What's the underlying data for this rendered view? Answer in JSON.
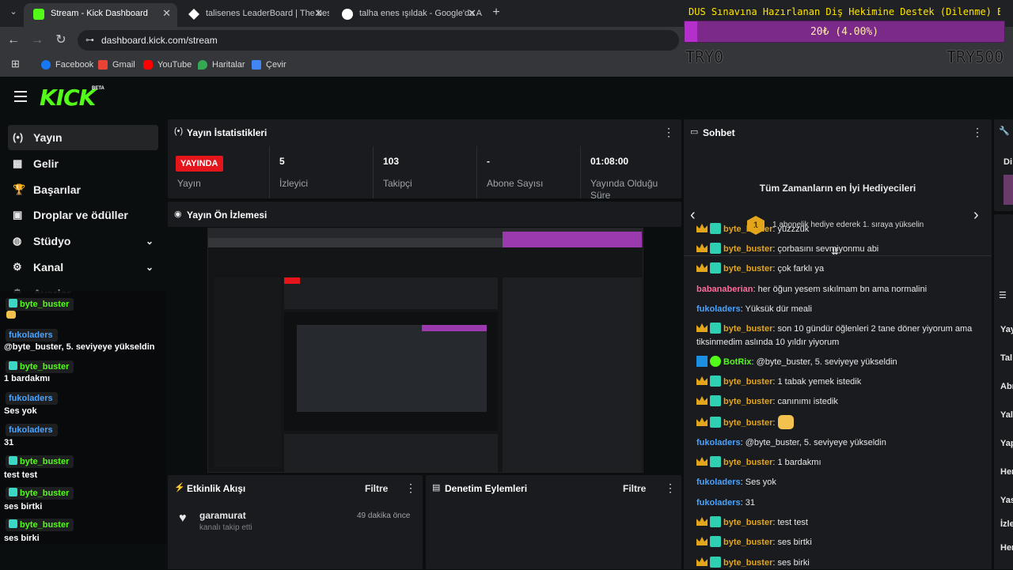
{
  "browser": {
    "tabs": [
      {
        "title": "Stream - Kick Dashboard",
        "active": true
      },
      {
        "title": "talisenes LeaderBoard | The bes"
      },
      {
        "title": "talha enes ışıldak - Google'da A"
      }
    ],
    "new_tab": "+",
    "url": "dashboard.kick.com/stream",
    "bookmarks": [
      "Facebook",
      "Gmail",
      "YouTube",
      "Haritalar",
      "Çevir"
    ]
  },
  "donation": {
    "title": "DUS Sınavına Hazırlanan Diş Hekimine Destek (Dilenme) Barı",
    "amount": "20₺ (4.00%)",
    "progress_fraction": 0.04,
    "min_label": "TRY0",
    "max_label": "TRY500"
  },
  "app": {
    "logo": "KICK",
    "logo_beta": "BETA",
    "nav": [
      {
        "label": "Yayın",
        "icon": "broadcast-icon",
        "glyph": "(•)"
      },
      {
        "label": "Gelir",
        "icon": "revenue-icon",
        "glyph": "▦"
      },
      {
        "label": "Başarılar",
        "icon": "trophy-icon",
        "glyph": "🏆"
      },
      {
        "label": "Droplar ve ödüller",
        "icon": "gift-icon",
        "glyph": "▣"
      },
      {
        "label": "Stüdyo",
        "icon": "studio-icon",
        "glyph": "◍",
        "chevron": "⌄"
      },
      {
        "label": "Kanal",
        "icon": "channel-icon",
        "glyph": "⚙",
        "chevron": "⌄"
      },
      {
        "label": "Ayarlar",
        "icon": "settings-icon",
        "glyph": "⚙",
        "chevron": "⌄"
      }
    ]
  },
  "overlay_chat": [
    {
      "user": "byte_buster",
      "msg": "",
      "emote": true,
      "color": "#53fc18"
    },
    {
      "user": "fukoladers",
      "msg": "@byte_buster, 5. seviyeye yükseldin",
      "color": "#4aa3ff"
    },
    {
      "user": "byte_buster",
      "msg": "1 bardakmı",
      "color": "#53fc18"
    },
    {
      "user": "fukoladers",
      "msg": "Ses yok",
      "color": "#4aa3ff"
    },
    {
      "user": "fukoladers",
      "msg": "31",
      "color": "#4aa3ff"
    },
    {
      "user": "byte_buster",
      "msg": "test test",
      "color": "#53fc18"
    },
    {
      "user": "byte_buster",
      "msg": "ses birtki",
      "color": "#53fc18"
    },
    {
      "user": "byte_buster",
      "msg": "ses birki",
      "color": "#53fc18"
    }
  ],
  "stats": {
    "title": "Yayın İstatistikleri",
    "live_badge": "YAYINDA",
    "columns": [
      {
        "value": "",
        "label": "Yayın"
      },
      {
        "value": "5",
        "label": "İzleyici"
      },
      {
        "value": "103",
        "label": "Takipçi"
      },
      {
        "value": "-",
        "label": "Abone Sayısı"
      },
      {
        "value": "01:08:00",
        "label": "Yayında Olduğu Süre"
      }
    ]
  },
  "preview": {
    "title": "Yayın Ön İzlemesi"
  },
  "events": {
    "title": "Etkinlik Akışı",
    "filter": "Filtre",
    "items": [
      {
        "user": "garamurat",
        "desc": "kanalı takip etti",
        "time": "49 dakika önce"
      }
    ]
  },
  "moderation": {
    "title": "Denetim Eylemleri",
    "filter": "Filtre"
  },
  "chat": {
    "title": "Sohbet",
    "gifters_title": "Tüm Zamanların en İyi Hediyecileri",
    "gifters_rank": "1",
    "gifters_text": "1 abonelik hediye ederek 1. sıraya yükselin",
    "messages": [
      {
        "user": "byte_buster",
        "text": ": yüzzzük",
        "badges": "crown,teal",
        "color": "#e3a51b"
      },
      {
        "user": "byte_buster",
        "text": ": çorbasını sevmiyonmu abi",
        "badges": "crown,teal",
        "color": "#e3a51b"
      },
      {
        "user": "byte_buster",
        "text": ": çok farklı ya",
        "badges": "crown,teal",
        "color": "#e3a51b"
      },
      {
        "user": "babanaberian",
        "text": ": her öğun yesem sıkılmam bn ama normalini",
        "badges": "",
        "color": "#ff6b9a"
      },
      {
        "user": "fukoladers",
        "text": ": Yüksük dür meali",
        "badges": "",
        "color": "#4aa3ff"
      },
      {
        "user": "byte_buster",
        "text": ": son 10 gündür öğlenleri 2 tane döner yiyorum ama tiksinmedim aslında 10 yıldır yiyorum",
        "badges": "crown,teal",
        "color": "#e3a51b"
      },
      {
        "user": "BotRix",
        "text": ": @byte_buster, 5. seviyeye yükseldin",
        "badges": "bot,green",
        "color": "#53fc18"
      },
      {
        "user": "byte_buster",
        "text": ": 1 tabak yemek istedik",
        "badges": "crown,teal",
        "color": "#e3a51b"
      },
      {
        "user": "byte_buster",
        "text": ": canınımı istedik",
        "badges": "crown,teal",
        "color": "#e3a51b"
      },
      {
        "user": "byte_buster",
        "text": ":",
        "badges": "crown,teal",
        "color": "#e3a51b",
        "emote": true
      },
      {
        "user": "fukoladers",
        "text": ": @byte_buster, 5. seviyeye yükseldin",
        "badges": "",
        "color": "#4aa3ff"
      },
      {
        "user": "byte_buster",
        "text": ": 1 bardakmı",
        "badges": "crown,teal",
        "color": "#e3a51b"
      },
      {
        "user": "fukoladers",
        "text": ": Ses yok",
        "badges": "",
        "color": "#4aa3ff"
      },
      {
        "user": "fukoladers",
        "text": ": 31",
        "badges": "",
        "color": "#4aa3ff"
      },
      {
        "user": "byte_buster",
        "text": ": test test",
        "badges": "crown,teal",
        "color": "#e3a51b"
      },
      {
        "user": "byte_buster",
        "text": ": ses birtki",
        "badges": "crown,teal",
        "color": "#e3a51b"
      },
      {
        "user": "byte_buster",
        "text": ": ses birki",
        "badges": "crown,teal",
        "color": "#e3a51b"
      }
    ]
  },
  "right_cut": {
    "top": "Di",
    "labels": [
      "Yay",
      "Tal",
      "Abı",
      "Yal",
      "Yap",
      "Her",
      "Yas",
      "İzle",
      "Her"
    ]
  }
}
